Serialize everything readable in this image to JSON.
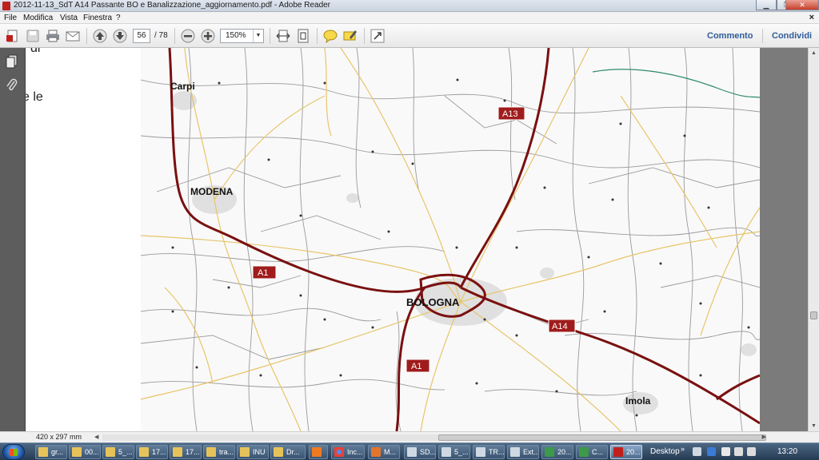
{
  "window": {
    "title": "2012-11-13_SdT A14 Passante BO e Banalizzazione_aggiornamento.pdf - Adobe Reader",
    "minimize": "▁",
    "restore": "❐",
    "close": "✕"
  },
  "menubar": {
    "items": [
      "File",
      "Modifica",
      "Vista",
      "Finestra",
      "?"
    ],
    "close": "×"
  },
  "toolbar": {
    "page_number": "56",
    "page_total": "/ 78",
    "zoom": "150%",
    "comment_label": "Commento",
    "share_label": "Condividi"
  },
  "document": {
    "page_text_fragments": [
      "di",
      "e le"
    ],
    "map": {
      "cities": [
        "Carpi",
        "MODENA",
        "BOLOGNA",
        "Imola"
      ],
      "highway_labels": [
        "A13",
        "A1",
        "A14",
        "A1"
      ]
    }
  },
  "statusbar": {
    "page_size": "420 x 297 mm"
  },
  "taskbar": {
    "tasks": [
      "gr...",
      "00...",
      "5_...",
      "17...",
      "17...",
      "tra...",
      "INU",
      "Dr...",
      "",
      "Inc...",
      "M...",
      "SD...",
      "5_...",
      "TR...",
      "Ext...",
      "20...",
      "C...",
      "20..."
    ],
    "desktop_label": "Desktop",
    "tray_chevron": "»",
    "time": "13:20"
  },
  "colors": {
    "highway": "#7a1010",
    "highway_label_bg": "#a01c1c",
    "secondary_road": "#e8c56a",
    "local_road": "#8f8f8f",
    "railway": "#2e8a6a",
    "accent_link": "#2f5d9b",
    "nav_pane": "#5d5d5d"
  }
}
